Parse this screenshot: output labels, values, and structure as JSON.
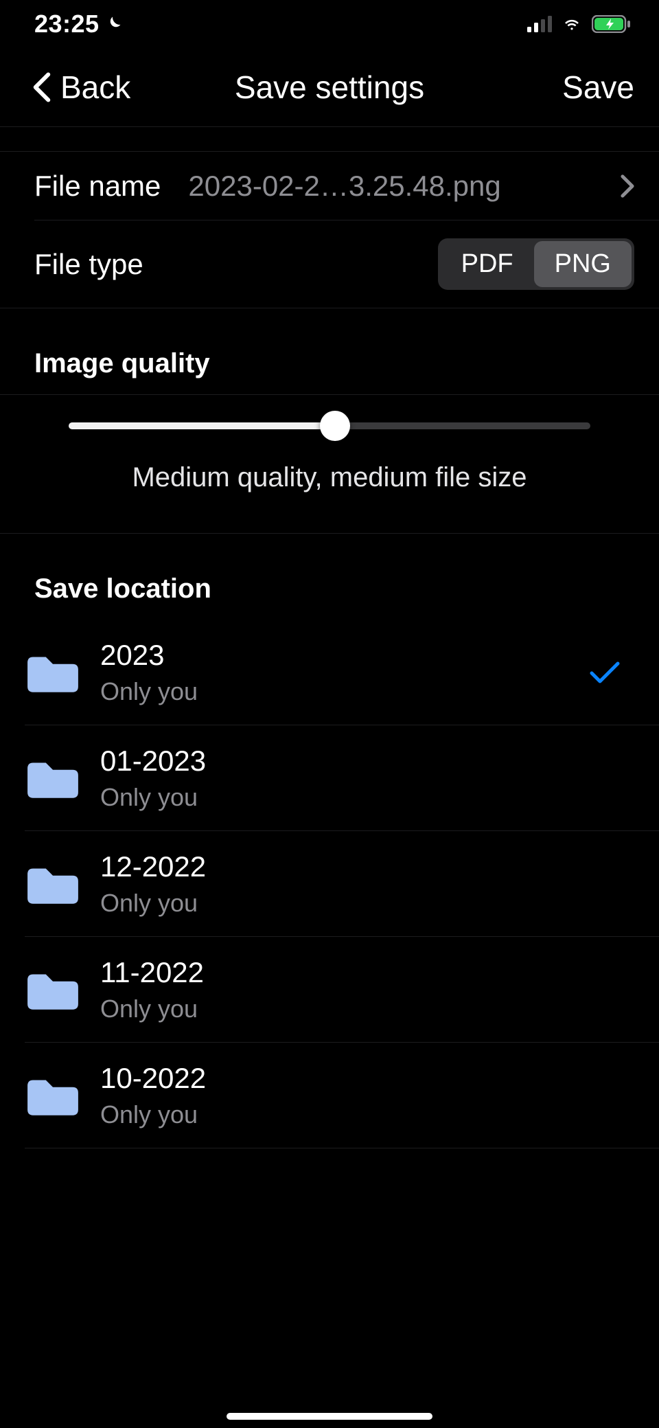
{
  "status": {
    "time": "23:25"
  },
  "nav": {
    "back_label": "Back",
    "title": "Save settings",
    "save_label": "Save"
  },
  "file": {
    "name_label": "File name",
    "name_value": "2023-02-2…3.25.48.png",
    "type_label": "File type",
    "type_options": [
      "PDF",
      "PNG"
    ],
    "type_selected": "PNG"
  },
  "quality": {
    "header": "Image quality",
    "value_percent": 50,
    "caption": "Medium quality, medium file size"
  },
  "location": {
    "header": "Save location",
    "folders": [
      {
        "name": "2023",
        "sub": "Only you",
        "selected": true
      },
      {
        "name": "01-2023",
        "sub": "Only you",
        "selected": false
      },
      {
        "name": "12-2022",
        "sub": "Only you",
        "selected": false
      },
      {
        "name": "11-2022",
        "sub": "Only you",
        "selected": false
      },
      {
        "name": "10-2022",
        "sub": "Only you",
        "selected": false
      }
    ]
  },
  "colors": {
    "background": "#000000",
    "text": "#ffffff",
    "secondary_text": "#8e8e93",
    "folder_icon": "#a7c5f5",
    "check": "#0a84ff",
    "battery_fill": "#30d158"
  }
}
